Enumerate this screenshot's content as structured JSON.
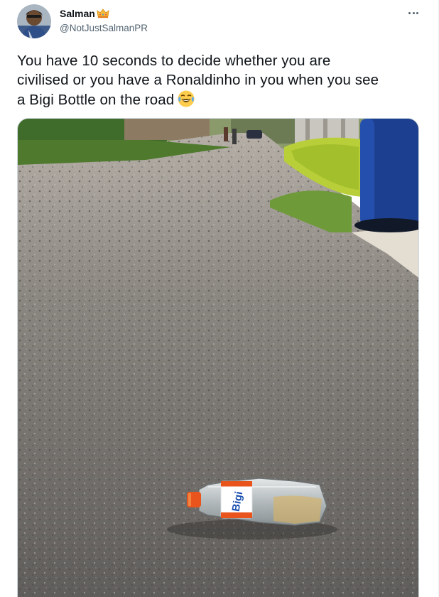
{
  "author": {
    "display_name": "Salman",
    "badge_icon": "crown-icon",
    "handle": "@NotJustSalmanPR",
    "avatar_icon": "profile-avatar"
  },
  "tweet": {
    "line1": "You have 10 seconds to decide whether you are",
    "line2": "civilised or you have a Ronaldinho in you when you see",
    "line3": "a Bigi Bottle on the road",
    "emoji_icon": "tears-of-joy-emoji-icon"
  },
  "media": {
    "bottle_label": "Bigi",
    "accent_color": "#e8541c"
  },
  "menu": {
    "more_icon": "more-options-icon"
  }
}
